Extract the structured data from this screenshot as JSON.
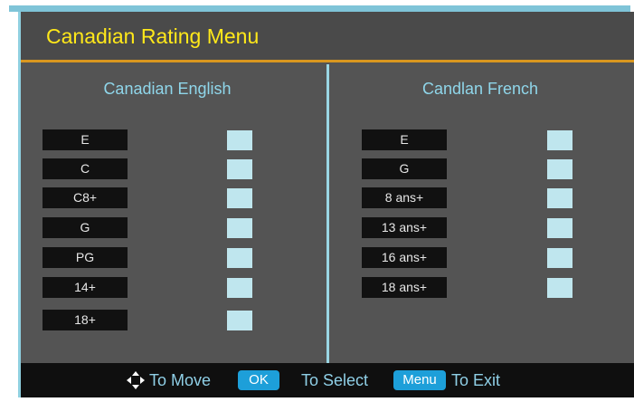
{
  "title": "Canadian Rating Menu",
  "columns": {
    "english": {
      "title": "Canadian English",
      "items": [
        "E",
        "C",
        "C8+",
        "G",
        "PG",
        "14+",
        "18+"
      ]
    },
    "french": {
      "title": "Candlan French",
      "items": [
        "E",
        "G",
        "8 ans+",
        "13 ans+",
        "16 ans+",
        "18 ans+"
      ]
    }
  },
  "footer": {
    "move_icon": "dpad-arrows-icon",
    "move_text": "To Move",
    "ok_key": "OK",
    "select_text": "To Select",
    "menu_key": "Menu",
    "exit_text": "To Exit"
  },
  "colors": {
    "title": "#ffe81a",
    "accent_line": "#d9971f",
    "column_title": "#8fd6ea",
    "key_badge": "#1d9fd9"
  }
}
